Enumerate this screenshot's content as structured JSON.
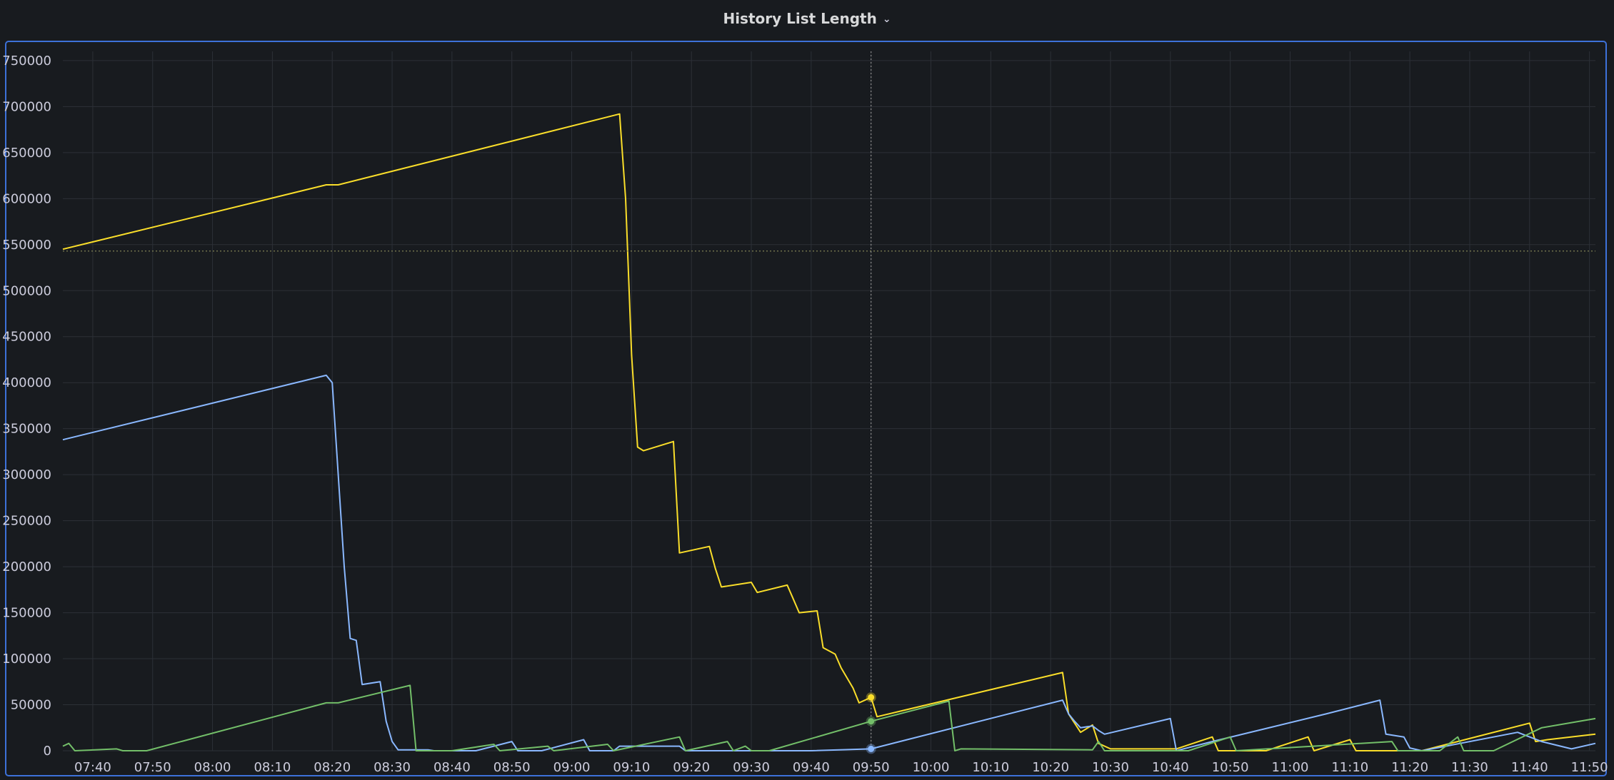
{
  "panel": {
    "title": "History List Length"
  },
  "icons": {
    "title_dropdown": "chevron-down-icon"
  },
  "colors": {
    "background": "#181b1f",
    "grid": "#2c3037",
    "panel_border": "#3d71d9",
    "series_yellow": "#fade2a",
    "series_blue": "#8ab8ff",
    "series_green": "#73bf69",
    "crosshair": "#8e8e8e",
    "threshold": "#8c8c5a"
  },
  "chart_data": {
    "type": "line",
    "title": "History List Length",
    "xlabel": "",
    "ylabel": "",
    "ylim": [
      0,
      760000
    ],
    "xlim": [
      "07:35",
      "11:51"
    ],
    "yticks": [
      0,
      50000,
      100000,
      150000,
      200000,
      250000,
      300000,
      350000,
      400000,
      450000,
      500000,
      550000,
      600000,
      650000,
      700000,
      750000
    ],
    "xticks": [
      "07:40",
      "07:50",
      "08:00",
      "08:10",
      "08:20",
      "08:30",
      "08:40",
      "08:50",
      "09:00",
      "09:10",
      "09:20",
      "09:30",
      "09:40",
      "09:50",
      "10:00",
      "10:10",
      "10:20",
      "10:30",
      "10:40",
      "10:50",
      "11:00",
      "11:10",
      "11:20",
      "11:30",
      "11:40",
      "11:50"
    ],
    "grid": true,
    "legend": "none",
    "hover": {
      "x": "09:50",
      "threshold_y": 543000
    },
    "series": [
      {
        "color": "#fade2a",
        "points": [
          [
            "07:35",
            545000
          ],
          [
            "08:19",
            615000
          ],
          [
            "08:21",
            615000
          ],
          [
            "09:08",
            692000
          ],
          [
            "09:09",
            600000
          ],
          [
            "09:10",
            430000
          ],
          [
            "09:11",
            330000
          ],
          [
            "09:12",
            326000
          ],
          [
            "09:17",
            336000
          ],
          [
            "09:18",
            215000
          ],
          [
            "09:23",
            222000
          ],
          [
            "09:24",
            198000
          ],
          [
            "09:25",
            178000
          ],
          [
            "09:30",
            183000
          ],
          [
            "09:31",
            172000
          ],
          [
            "09:36",
            180000
          ],
          [
            "09:37",
            165000
          ],
          [
            "09:38",
            150000
          ],
          [
            "09:41",
            152000
          ],
          [
            "09:42",
            112000
          ],
          [
            "09:44",
            105000
          ],
          [
            "09:45",
            90000
          ],
          [
            "09:47",
            68000
          ],
          [
            "09:48",
            52000
          ],
          [
            "09:50",
            58000
          ],
          [
            "09:51",
            37000
          ],
          [
            "10:22",
            85000
          ],
          [
            "10:23",
            40000
          ],
          [
            "10:25",
            20000
          ],
          [
            "10:27",
            28000
          ],
          [
            "10:28",
            8000
          ],
          [
            "10:30",
            2000
          ],
          [
            "10:41",
            2000
          ],
          [
            "10:47",
            15000
          ],
          [
            "10:48",
            0
          ],
          [
            "10:56",
            0
          ],
          [
            "11:03",
            15000
          ],
          [
            "11:04",
            0
          ],
          [
            "11:10",
            12000
          ],
          [
            "11:11",
            0
          ],
          [
            "11:22",
            0
          ],
          [
            "11:40",
            30000
          ],
          [
            "11:41",
            10000
          ],
          [
            "11:43",
            12000
          ],
          [
            "11:51",
            18000
          ]
        ]
      },
      {
        "color": "#8ab8ff",
        "points": [
          [
            "07:35",
            338000
          ],
          [
            "08:19",
            408000
          ],
          [
            "08:20",
            400000
          ],
          [
            "08:21",
            300000
          ],
          [
            "08:22",
            200000
          ],
          [
            "08:23",
            122000
          ],
          [
            "08:24",
            120000
          ],
          [
            "08:25",
            72000
          ],
          [
            "08:28",
            75000
          ],
          [
            "08:29",
            32000
          ],
          [
            "08:30",
            10000
          ],
          [
            "08:31",
            1000
          ],
          [
            "08:36",
            1000
          ],
          [
            "08:37",
            0
          ],
          [
            "08:44",
            0
          ],
          [
            "08:50",
            10000
          ],
          [
            "08:51",
            0
          ],
          [
            "08:55",
            0
          ],
          [
            "09:02",
            12000
          ],
          [
            "09:03",
            0
          ],
          [
            "09:07",
            0
          ],
          [
            "09:08",
            5000
          ],
          [
            "09:18",
            5000
          ],
          [
            "09:19",
            0
          ],
          [
            "09:40",
            0
          ],
          [
            "09:50",
            2000
          ],
          [
            "10:22",
            55000
          ],
          [
            "10:23",
            40000
          ],
          [
            "10:24",
            32000
          ],
          [
            "10:25",
            25000
          ],
          [
            "10:27",
            27000
          ],
          [
            "10:28",
            22000
          ],
          [
            "10:29",
            18000
          ],
          [
            "10:40",
            35000
          ],
          [
            "10:41",
            0
          ],
          [
            "10:47",
            10000
          ],
          [
            "11:06",
            40000
          ],
          [
            "11:15",
            55000
          ],
          [
            "11:16",
            18000
          ],
          [
            "11:19",
            15000
          ],
          [
            "11:20",
            3000
          ],
          [
            "11:22",
            0
          ],
          [
            "11:26",
            5000
          ],
          [
            "11:38",
            20000
          ],
          [
            "11:42",
            10000
          ],
          [
            "11:47",
            2000
          ],
          [
            "11:51",
            8000
          ]
        ]
      },
      {
        "color": "#73bf69",
        "points": [
          [
            "07:35",
            5000
          ],
          [
            "07:36",
            8000
          ],
          [
            "07:37",
            0
          ],
          [
            "07:44",
            2000
          ],
          [
            "07:45",
            0
          ],
          [
            "07:49",
            0
          ],
          [
            "08:19",
            52000
          ],
          [
            "08:21",
            52000
          ],
          [
            "08:33",
            71000
          ],
          [
            "08:34",
            0
          ],
          [
            "08:40",
            0
          ],
          [
            "08:47",
            7000
          ],
          [
            "08:48",
            0
          ],
          [
            "08:56",
            5000
          ],
          [
            "08:57",
            0
          ],
          [
            "09:06",
            7000
          ],
          [
            "09:07",
            0
          ],
          [
            "09:18",
            15000
          ],
          [
            "09:19",
            0
          ],
          [
            "09:26",
            10000
          ],
          [
            "09:27",
            0
          ],
          [
            "09:29",
            5000
          ],
          [
            "09:30",
            0
          ],
          [
            "09:33",
            0
          ],
          [
            "09:50",
            32000
          ],
          [
            "10:03",
            54000
          ],
          [
            "10:04",
            0
          ],
          [
            "10:05",
            2000
          ],
          [
            "10:27",
            1000
          ],
          [
            "10:28",
            10000
          ],
          [
            "10:29",
            0
          ],
          [
            "10:43",
            0
          ],
          [
            "10:50",
            15000
          ],
          [
            "10:51",
            0
          ],
          [
            "11:17",
            10000
          ],
          [
            "11:18",
            0
          ],
          [
            "11:25",
            0
          ],
          [
            "11:28",
            15000
          ],
          [
            "11:29",
            0
          ],
          [
            "11:34",
            0
          ],
          [
            "11:42",
            25000
          ],
          [
            "11:51",
            35000
          ]
        ]
      }
    ]
  }
}
